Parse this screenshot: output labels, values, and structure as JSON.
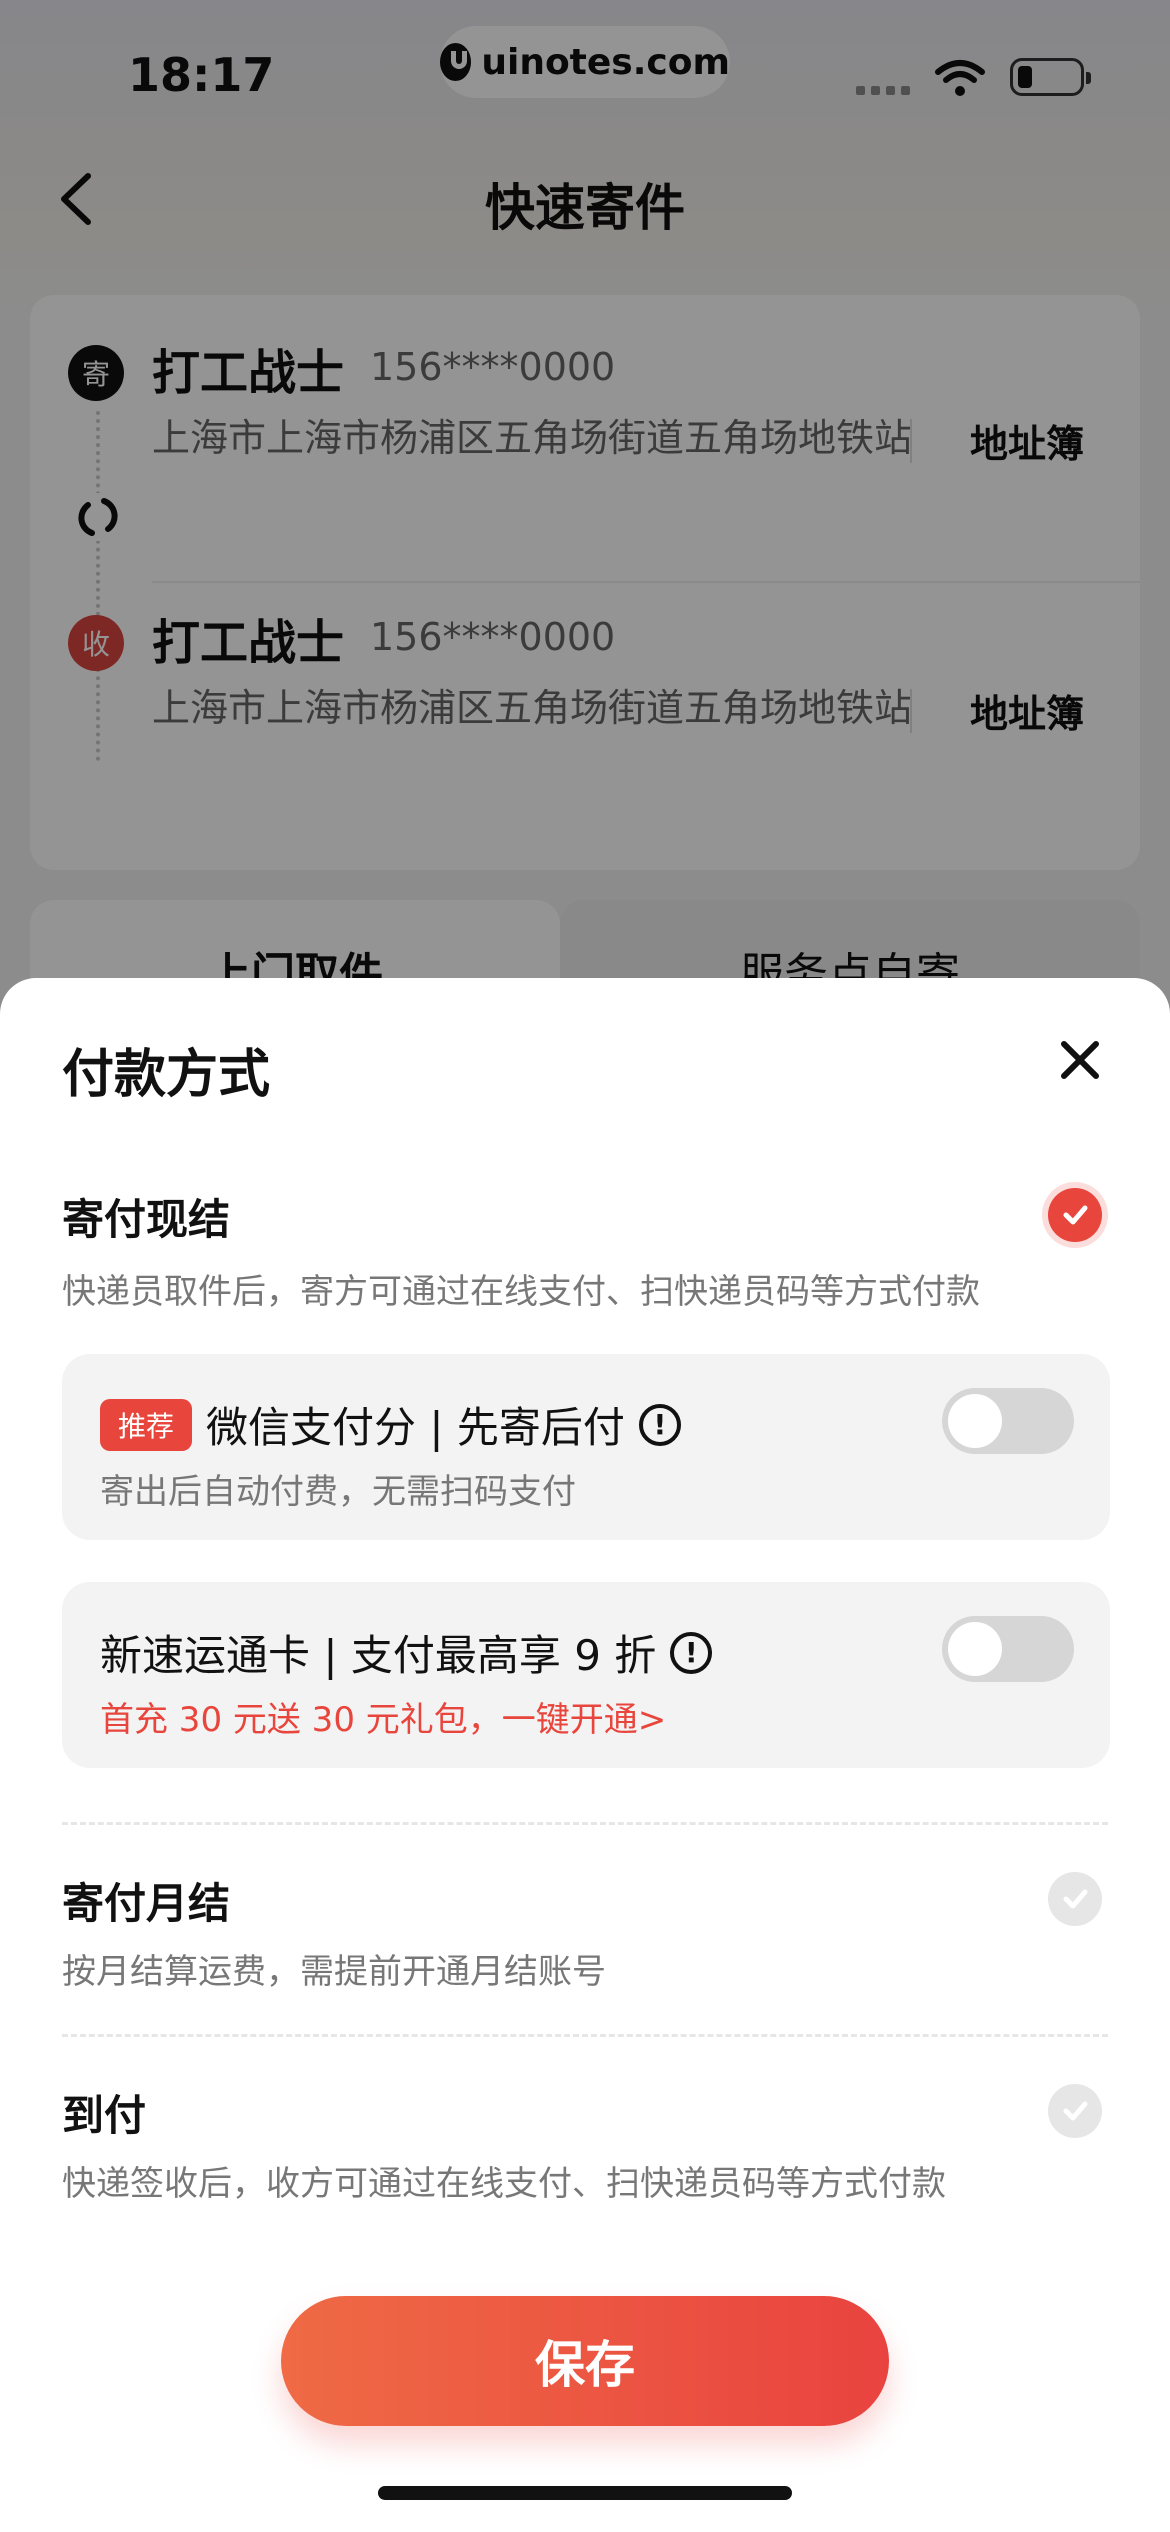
{
  "status_bar": {
    "time": "18:17",
    "watermark": "uinotes.com"
  },
  "nav": {
    "title": "快速寄件"
  },
  "sender": {
    "badge": "寄",
    "name": "打工战士",
    "phone": "156****0000",
    "address": "上海市上海市杨浦区五角场街道五角场地铁站",
    "book_label": "地址簿"
  },
  "receiver": {
    "badge": "收",
    "name": "打工战士",
    "phone": "156****0000",
    "address": "上海市上海市杨浦区五角场街道五角场地铁站",
    "book_label": "地址簿"
  },
  "tabs": [
    {
      "label": "上门取件",
      "active": true
    },
    {
      "label": "服务点自寄",
      "active": false
    }
  ],
  "payment_sheet": {
    "title": "付款方式",
    "options": [
      {
        "title": "寄付现结",
        "desc": "快递员取件后，寄方可通过在线支付、扫快递员码等方式付款",
        "selected": true,
        "sub_options": [
          {
            "badge": "推荐",
            "title": "微信支付分 | 先寄后付",
            "desc": "寄出后自动付费，无需扫码支付",
            "enabled": false
          },
          {
            "title": "新速运通卡 | 支付最高享 9 折",
            "desc": "首充 30 元送 30 元礼包，一键开通>",
            "enabled": false
          }
        ]
      },
      {
        "title": "寄付月结",
        "desc": "按月结算运费，需提前开通月结账号",
        "selected": false
      },
      {
        "title": "到付",
        "desc": "快递签收后，收方可通过在线支付、扫快递员码等方式付款",
        "selected": false
      }
    ],
    "save_label": "保存"
  },
  "colors": {
    "accent": "#e8453c",
    "accent_start": "#ef6a45"
  },
  "icons": {
    "back": "chevron-left-icon",
    "close": "close-icon",
    "swap": "swap-icon",
    "info": "info-icon",
    "check": "check-icon"
  }
}
